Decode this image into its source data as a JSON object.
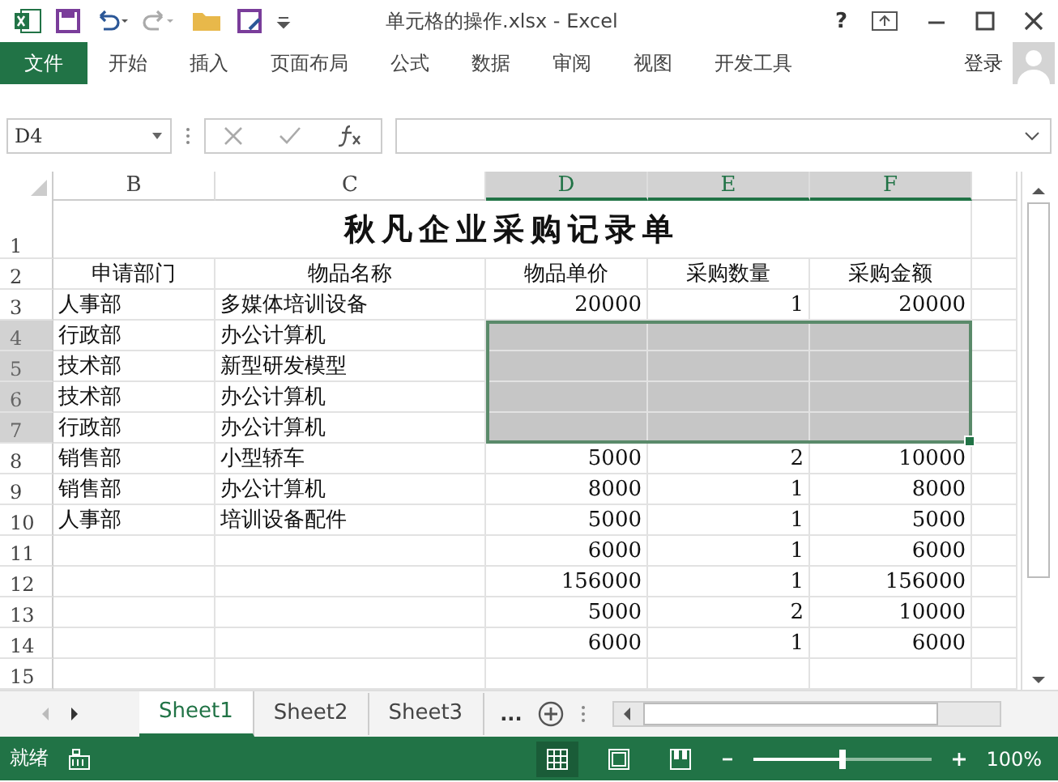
{
  "window": {
    "title": "单元格的操作.xlsx - Excel",
    "help": "?"
  },
  "ribbon": {
    "tabs": [
      {
        "label": "文件",
        "selected": true
      },
      {
        "label": "开始",
        "selected": false
      },
      {
        "label": "插入",
        "selected": false
      },
      {
        "label": "页面布局",
        "selected": false
      },
      {
        "label": "公式",
        "selected": false
      },
      {
        "label": "数据",
        "selected": false
      },
      {
        "label": "审阅",
        "selected": false
      },
      {
        "label": "视图",
        "selected": false
      },
      {
        "label": "开发工具",
        "selected": false
      }
    ],
    "sign_in": "登录"
  },
  "formula_bar": {
    "name_box": "D4"
  },
  "sheet": {
    "columns": [
      {
        "label": "B",
        "selected": false
      },
      {
        "label": "C",
        "selected": false
      },
      {
        "label": "D",
        "selected": true
      },
      {
        "label": "E",
        "selected": true
      },
      {
        "label": "F",
        "selected": true
      }
    ],
    "title_row": {
      "row": "1",
      "text": "秋凡企业采购记录单"
    },
    "rows": [
      {
        "row": "2",
        "kind": "header",
        "selected": false,
        "cells": [
          "申请部门",
          "物品名称",
          "物品单价",
          "采购数量",
          "采购金额"
        ]
      },
      {
        "row": "3",
        "kind": "data",
        "selected": false,
        "cells": [
          "人事部",
          "多媒体培训设备",
          "20000",
          "1",
          "20000"
        ]
      },
      {
        "row": "4",
        "kind": "data",
        "selected": true,
        "cells": [
          "行政部",
          "办公计算机",
          null,
          null,
          null
        ]
      },
      {
        "row": "5",
        "kind": "data",
        "selected": true,
        "cells": [
          "技术部",
          "新型研发模型",
          null,
          null,
          null
        ]
      },
      {
        "row": "6",
        "kind": "data",
        "selected": true,
        "cells": [
          "技术部",
          "办公计算机",
          null,
          null,
          null
        ]
      },
      {
        "row": "7",
        "kind": "data",
        "selected": true,
        "cells": [
          "行政部",
          "办公计算机",
          null,
          null,
          null
        ]
      },
      {
        "row": "8",
        "kind": "data",
        "selected": false,
        "cells": [
          "销售部",
          "小型轿车",
          "5000",
          "2",
          "10000"
        ]
      },
      {
        "row": "9",
        "kind": "data",
        "selected": false,
        "cells": [
          "销售部",
          "办公计算机",
          "8000",
          "1",
          "8000"
        ]
      },
      {
        "row": "10",
        "kind": "data",
        "selected": false,
        "cells": [
          "人事部",
          "培训设备配件",
          "5000",
          "1",
          "5000"
        ]
      },
      {
        "row": "11",
        "kind": "data",
        "selected": false,
        "cells": [
          null,
          null,
          "6000",
          "1",
          "6000"
        ]
      },
      {
        "row": "12",
        "kind": "data",
        "selected": false,
        "cells": [
          null,
          null,
          "156000",
          "1",
          "156000"
        ]
      },
      {
        "row": "13",
        "kind": "data",
        "selected": false,
        "cells": [
          null,
          null,
          "5000",
          "2",
          "10000"
        ]
      },
      {
        "row": "14",
        "kind": "data",
        "selected": false,
        "cells": [
          null,
          null,
          "6000",
          "1",
          "6000"
        ]
      },
      {
        "row": "15",
        "kind": "data",
        "selected": false,
        "cells": [
          null,
          null,
          null,
          null,
          null
        ]
      }
    ]
  },
  "sheet_tabs": {
    "tabs": [
      {
        "label": "Sheet1",
        "selected": true
      },
      {
        "label": "Sheet2",
        "selected": false
      },
      {
        "label": "Sheet3",
        "selected": false
      }
    ],
    "more": "..."
  },
  "status_bar": {
    "status": "就绪",
    "zoom": {
      "level": 0.5,
      "reading": "100%"
    }
  }
}
